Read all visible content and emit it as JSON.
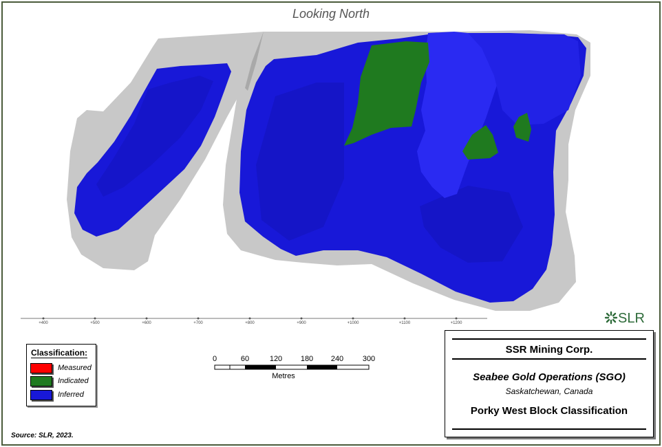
{
  "view_title": "Looking North",
  "axis": {
    "ticks": [
      "+400",
      "+500",
      "+600",
      "+700",
      "+800",
      "+900",
      "+1000",
      "+1100",
      "+1200"
    ]
  },
  "legend": {
    "title": "Classification:",
    "items": [
      {
        "label": "Measured",
        "color": "#ff0000"
      },
      {
        "label": "Indicated",
        "color": "#1f7a1f"
      },
      {
        "label": "Inferred",
        "color": "#1818d8"
      }
    ]
  },
  "scale_bar": {
    "labels": [
      "0",
      "60",
      "120",
      "180",
      "240",
      "300"
    ],
    "unit": "Metres"
  },
  "logo": {
    "text": "SLR"
  },
  "title_block": {
    "company": "SSR Mining Corp.",
    "operation": "Seabee Gold Operations (SGO)",
    "location": "Saskatchewan, Canada",
    "figure_title": "Porky West Block Classification"
  },
  "source": "Source:  SLR, 2023.",
  "colors": {
    "inferred": "#1818d8",
    "indicated": "#1f7a1f",
    "measured": "#ff0000",
    "envelope": "#c8c8c8",
    "logo": "#2e6b3a"
  }
}
